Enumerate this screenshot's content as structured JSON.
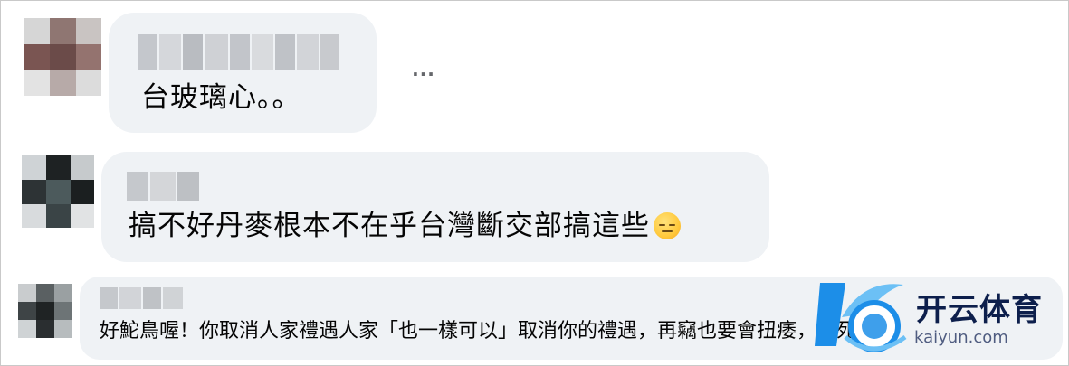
{
  "comments": [
    {
      "text": "台玻璃心。。",
      "emoji": null
    },
    {
      "text": "搞不好丹麥根本不在乎台灣斷交部搞這些",
      "emoji": "unamused-face-icon"
    },
    {
      "text": "好鮀鳥喔！你取消人家禮遇人家「也一樣可以」取消你的禮遇，再竊也要會扭痿，笑死"
    }
  ],
  "more_button": {
    "label": "···"
  },
  "watermark": {
    "brand": "开云体育",
    "url": "kaiyun.com"
  },
  "colors": {
    "bubble": "#eff2f5",
    "text": "#050505",
    "watermark_blue": "#1c8ee8",
    "watermark_navy": "#0d1f4c"
  }
}
